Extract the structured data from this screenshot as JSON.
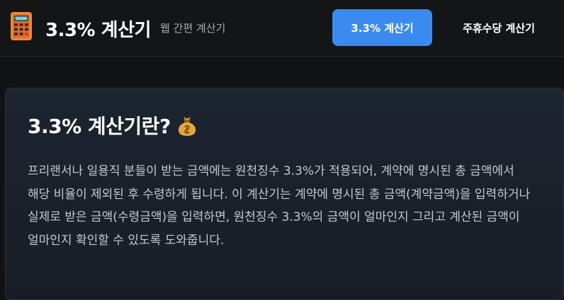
{
  "header": {
    "title": "3.3% 계산기",
    "subtitle": "웹 간편 계산기",
    "logo_icon": "calculator-icon",
    "nav": [
      {
        "label": "3.3% 계산기",
        "active": true
      },
      {
        "label": "주휴수당 계산기",
        "active": false
      }
    ]
  },
  "card": {
    "title": "3.3% 계산기란?",
    "title_icon": "money-bag-icon",
    "body": "프리랜서나 일용직 분들이 받는 금액에는 원천징수 3.3%가 적용되어, 계약에 명시된 총 금액에서 해당 비율이 제외된 후 수령하게 됩니다. 이 계산기는 계약에 명시된 총 금액(계약금액)을 입력하거나 실제로 받은 금액(수령금액)을 입력하면, 원천징수 3.3%의 금액이 얼마인지 그리고 계산된 금액이 얼마인지 확인할 수 있도록 도와줍니다."
  },
  "colors": {
    "accent": "#3b8af0",
    "background": "#111214",
    "card": "#1c2430"
  }
}
